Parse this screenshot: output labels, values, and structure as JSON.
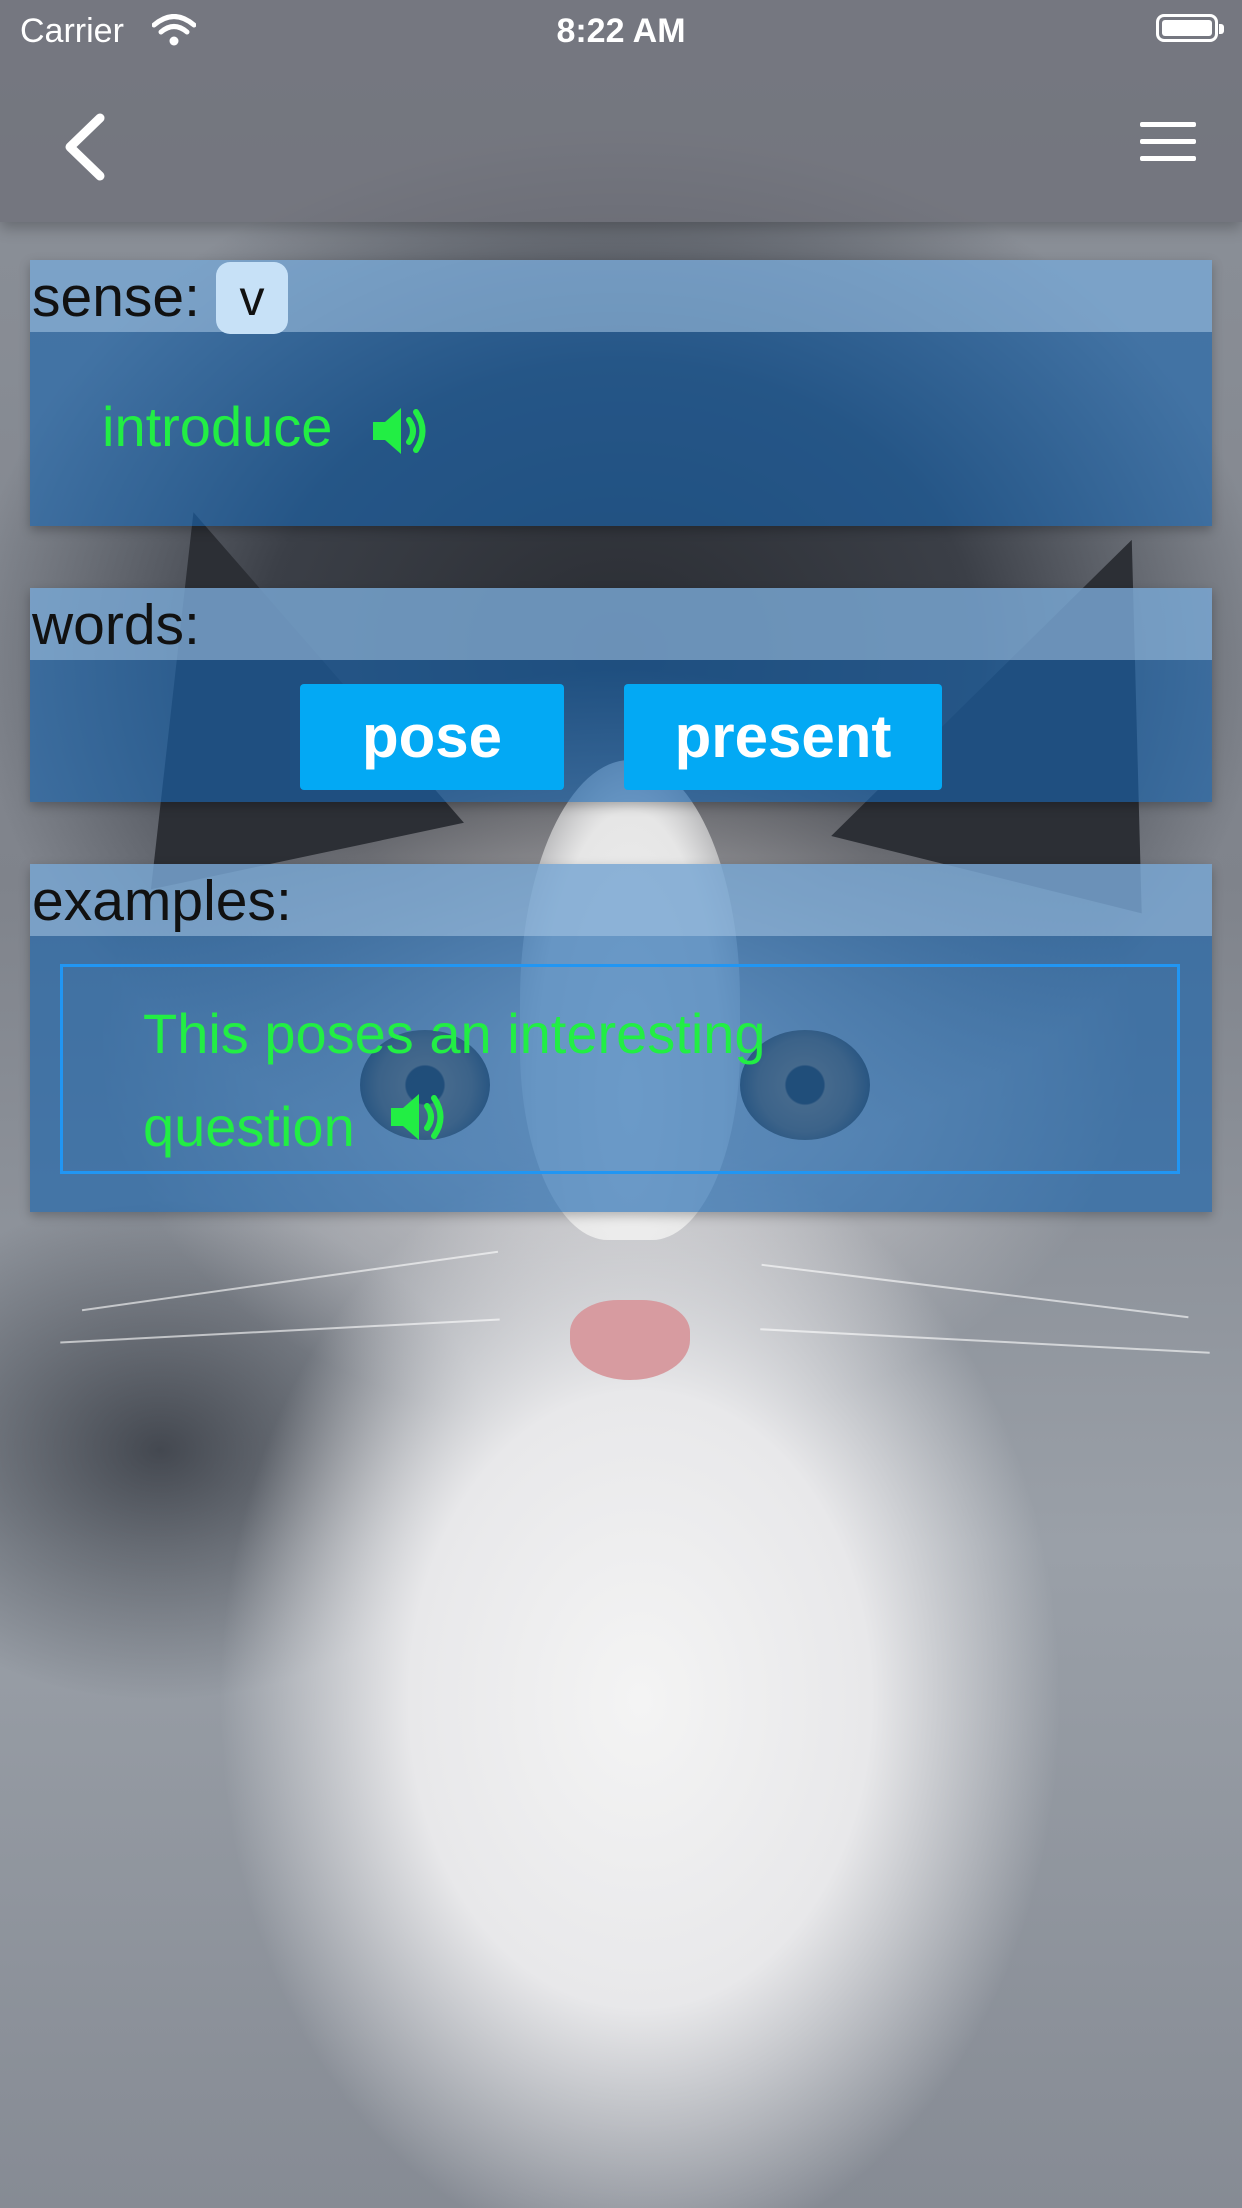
{
  "status_bar": {
    "carrier": "Carrier",
    "time": "8:22 AM"
  },
  "nav": {
    "back_icon": "chevron-left-icon",
    "menu_icon": "hamburger-menu-icon"
  },
  "sense": {
    "label": "sense:",
    "pos": "v",
    "meaning": "introduce",
    "speaker_icon": "speaker-icon"
  },
  "words": {
    "label": "words:",
    "items": [
      "pose",
      "present"
    ]
  },
  "examples": {
    "label": "examples:",
    "items": [
      "This poses an interesting question"
    ],
    "speaker_icon": "speaker-icon"
  },
  "colors": {
    "card": "#1964af",
    "word_button": "#03a9f4",
    "accent_green": "#22ee44",
    "chip": "#c7e1f7",
    "example_border": "#2196f3"
  }
}
